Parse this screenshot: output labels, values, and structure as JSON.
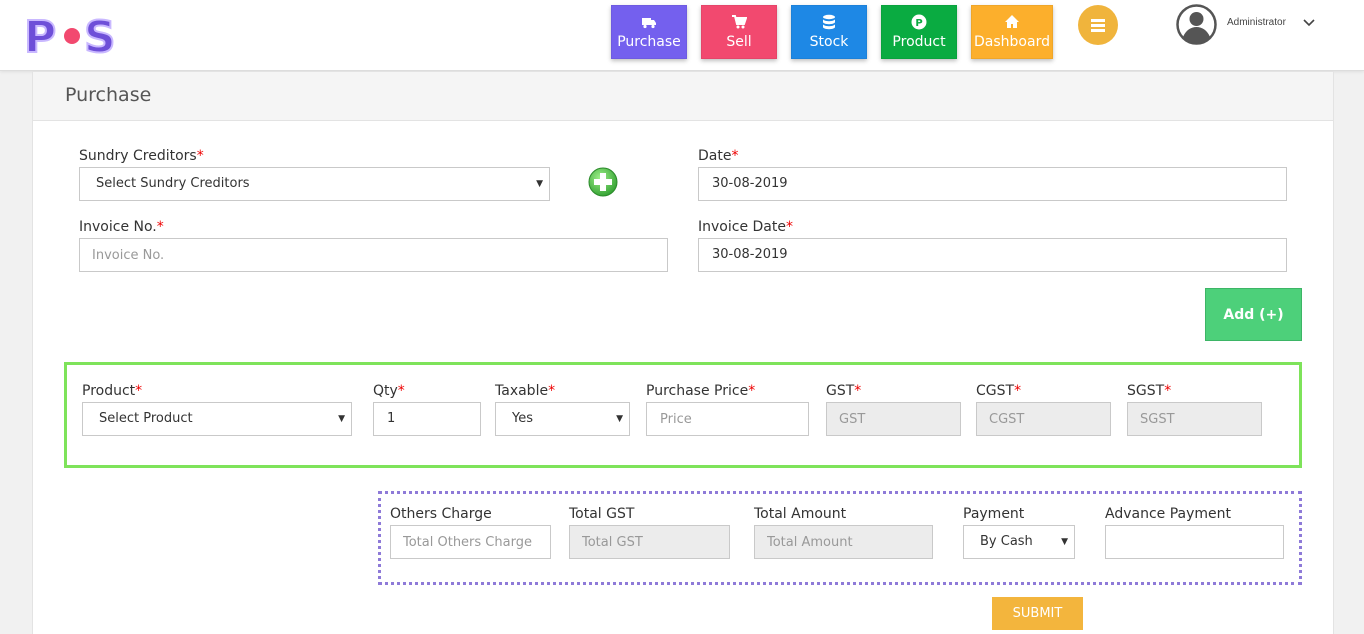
{
  "header": {
    "logo": "POS",
    "nav": [
      {
        "label": "Purchase",
        "icon": "truck-icon",
        "color": "#7460ee"
      },
      {
        "label": "Sell",
        "icon": "cart-icon",
        "color": "#f2496f"
      },
      {
        "label": "Stock",
        "icon": "database-icon",
        "color": "#1e88e5"
      },
      {
        "label": "Product",
        "icon": "product-p-icon",
        "color": "#0aab41"
      },
      {
        "label": "Dashboard",
        "icon": "home-icon",
        "color": "#fcaf2c"
      }
    ],
    "user": {
      "name": "Administrator"
    }
  },
  "page": {
    "title": "Purchase"
  },
  "form": {
    "sundry_creditors": {
      "label": "Sundry Creditors",
      "value": "Select Sundry Creditors"
    },
    "date": {
      "label": "Date",
      "value": "30-08-2019"
    },
    "invoice_no": {
      "label": "Invoice No.",
      "placeholder": "Invoice No."
    },
    "invoice_date": {
      "label": "Invoice Date",
      "value": "30-08-2019"
    },
    "add_button": "Add (+)"
  },
  "product_row": {
    "product": {
      "label": "Product",
      "value": "Select Product"
    },
    "qty": {
      "label": "Qty",
      "value": "1"
    },
    "taxable": {
      "label": "Taxable",
      "value": "Yes"
    },
    "purchase_price": {
      "label": "Purchase Price",
      "placeholder": "Price"
    },
    "gst": {
      "label": "GST",
      "placeholder": "GST"
    },
    "cgst": {
      "label": "CGST",
      "placeholder": "CGST"
    },
    "sgst": {
      "label": "SGST",
      "placeholder": "SGST"
    }
  },
  "totals": {
    "others_charge": {
      "label": "Others Charge",
      "placeholder": "Total Others Charge"
    },
    "total_gst": {
      "label": "Total GST",
      "placeholder": "Total GST"
    },
    "total_amount": {
      "label": "Total Amount",
      "placeholder": "Total Amount"
    },
    "payment": {
      "label": "Payment",
      "value": "By Cash"
    },
    "advance_payment": {
      "label": "Advance Payment",
      "value": ""
    }
  },
  "submit_label": "SUBMIT",
  "required_mark": "*"
}
